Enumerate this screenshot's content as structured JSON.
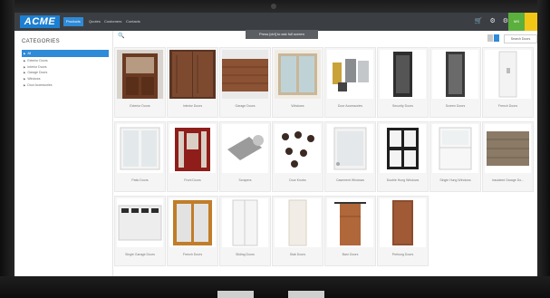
{
  "nav": {
    "logo": "ACME",
    "tabs": [
      {
        "label": "Products",
        "active": true
      },
      {
        "label": "Quotes",
        "active": false
      },
      {
        "label": "Customers",
        "active": false
      },
      {
        "label": "Contacts",
        "active": false
      }
    ],
    "user_initials": "MS",
    "accent": "#2f8ad8",
    "bar_color": "#3b3f44"
  },
  "tooltip": "Press [ctrl] to ask full screen",
  "sidebar": {
    "title": "CATEGORIES",
    "items": [
      {
        "label": "All",
        "selected": true
      },
      {
        "label": "Exterior Doors",
        "selected": false
      },
      {
        "label": "Interior Doors",
        "selected": false
      },
      {
        "label": "Garage Doors",
        "selected": false
      },
      {
        "label": "Windows",
        "selected": false
      },
      {
        "label": "Door Accessories",
        "selected": false
      }
    ]
  },
  "toolbar": {
    "search_button": "Search Doors"
  },
  "products": [
    {
      "label": "Exterior Doors",
      "icon": "wood-door-glass"
    },
    {
      "label": "Interior Doors",
      "icon": "wood-double-door"
    },
    {
      "label": "Garage Doors",
      "icon": "garage-door-wood"
    },
    {
      "label": "Windows",
      "icon": "window-frame"
    },
    {
      "label": "Door Accessories",
      "icon": "accessories"
    },
    {
      "label": "Security Doors",
      "icon": "security-door"
    },
    {
      "label": "Screen Doors",
      "icon": "screen-door"
    },
    {
      "label": "French Doors",
      "icon": "white-door"
    },
    {
      "label": "Patio Doors",
      "icon": "patio-door"
    },
    {
      "label": "Front Doors",
      "icon": "red-front-door"
    },
    {
      "label": "Scrapers",
      "icon": "scraper"
    },
    {
      "label": "Door Knobs",
      "icon": "knobs"
    },
    {
      "label": "Casement Windows",
      "icon": "casement-window"
    },
    {
      "label": "Double Hung Windows",
      "icon": "double-hung-window"
    },
    {
      "label": "Single Hung Windows",
      "icon": "single-hung-window"
    },
    {
      "label": "Insulated Garage Do...",
      "icon": "garage-door-brown"
    },
    {
      "label": "Single Garage Doors",
      "icon": "garage-door-white"
    },
    {
      "label": "French Doors",
      "icon": "french-doors-wood"
    },
    {
      "label": "Sliding Doors",
      "icon": "sliding-door"
    },
    {
      "label": "Slab Doors",
      "icon": "slab-door"
    },
    {
      "label": "Barn Doors",
      "icon": "barn-door"
    },
    {
      "label": "Prehung Doors",
      "icon": "prehung-door"
    }
  ]
}
